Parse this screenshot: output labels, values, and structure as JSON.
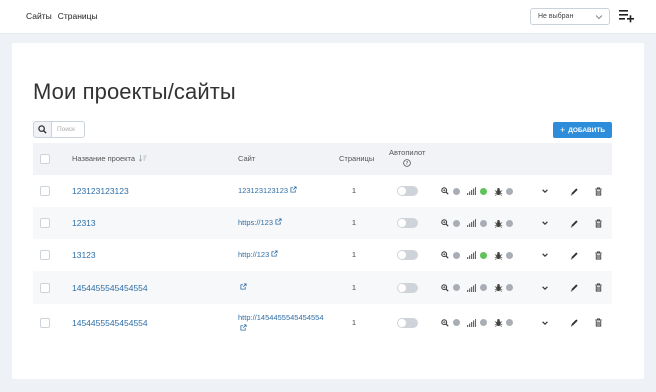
{
  "topbar": {
    "nav": [
      "Сайты",
      "Страницы"
    ],
    "select_value": "Не выбран"
  },
  "page": {
    "title": "Мои проекты/сайты",
    "search_placeholder": "Поиск",
    "add_button": "ДОБАВИТЬ"
  },
  "table": {
    "columns": {
      "name": "Название проекта",
      "site": "Сайт",
      "pages": "Страницы",
      "autopilot": "Автопилот"
    },
    "rows": [
      {
        "name": "123123123123",
        "site_line1": "123123123123",
        "site_line2": "",
        "pages": "1",
        "dots": [
          "gray",
          "green",
          "gray"
        ]
      },
      {
        "name": "12313",
        "site_line1": "https://123",
        "site_line2": "",
        "pages": "1",
        "dots": [
          "gray",
          "gray",
          "gray"
        ]
      },
      {
        "name": "13123",
        "site_line1": "http://123",
        "site_line2": "",
        "pages": "1",
        "dots": [
          "gray",
          "green",
          "gray"
        ]
      },
      {
        "name": "1454455545454554",
        "site_line1": "",
        "site_line2": "",
        "pages": "1",
        "dots": [
          "gray",
          "gray",
          "gray"
        ]
      },
      {
        "name": "1454455545454554",
        "site_line1": "http://1454455545454554",
        "site_line2": "",
        "pages": "1",
        "dots": [
          "gray",
          "gray",
          "gray"
        ]
      }
    ]
  },
  "colors": {
    "accent": "#2d8ddb",
    "link": "#2e6ea6",
    "dot_gray": "#a9aeb5",
    "dot_green": "#5ec45a"
  }
}
